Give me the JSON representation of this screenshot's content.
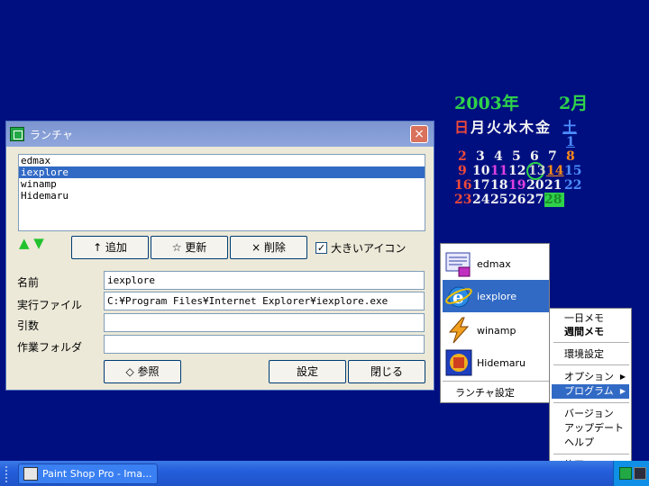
{
  "calendar": {
    "year": "2003年",
    "month": "2月",
    "weekdays": [
      "日",
      "月",
      "火",
      "水",
      "木",
      "金",
      "土"
    ],
    "weeks": [
      [
        "",
        "",
        "",
        "",
        "",
        "",
        "1"
      ],
      [
        "2",
        "3",
        "4",
        "5",
        "6",
        "7",
        "8"
      ],
      [
        "9",
        "10",
        "11",
        "12",
        "13",
        "14",
        "15"
      ],
      [
        "16",
        "17",
        "18",
        "19",
        "20",
        "21",
        "22"
      ],
      [
        "23",
        "24",
        "25",
        "26",
        "27",
        "28",
        ""
      ]
    ],
    "colors": {
      "title": "#2fd24a",
      "sunday": "#f04a3a",
      "saturday": "#4d8dff",
      "weekday": "#f2f2f2",
      "holiday": "#ff8a1a",
      "event": "#e040e0"
    }
  },
  "window": {
    "title": "ランチャ",
    "close_label": "×",
    "list_items": [
      "edmax",
      "iexplore",
      "winamp",
      "Hidemaru"
    ],
    "selected_item": "iexplore",
    "move_arrows": "▲ ▼",
    "add_button": "↑ 追加",
    "update_button": "☆ 更新",
    "delete_button": "× 削除",
    "large_icon_check": "✓",
    "large_icon_label": "大きいアイコン",
    "name_label": "名前",
    "name_value": "iexplore",
    "exec_label": "実行ファイル",
    "exec_value": "C:¥Program Files¥Internet Explorer¥iexplore.exe",
    "args_label": "引数",
    "args_value": "",
    "workdir_label": "作業フォルダ",
    "workdir_value": "",
    "browse_button": "◇ 参照",
    "settings_button": "設定",
    "close_button": "閉じる"
  },
  "icon_menu": {
    "items": [
      "edmax",
      "iexplore",
      "winamp",
      "Hidemaru"
    ],
    "selected": "iexplore",
    "settings_label": "ランチャ設定"
  },
  "context_menu": {
    "daily_memo": "一日メモ",
    "weekly_memo": "週間メモ",
    "env_settings": "環境設定",
    "options": "オプション",
    "program": "プログラム",
    "version": "バージョン",
    "update": "アップデート",
    "help": "ヘルプ",
    "exit": "終了"
  },
  "taskbar": {
    "task_label": "Paint Shop Pro - Ima..."
  }
}
